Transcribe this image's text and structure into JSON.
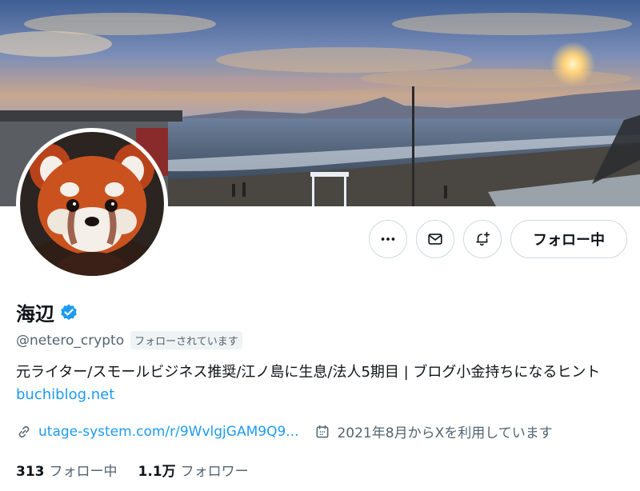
{
  "profile": {
    "display_name": "海辺",
    "handle": "@netero_crypto",
    "follows_you_badge": "フォローされています",
    "bio_text": "元ライター/スモールビジネス推奨/江ノ島に生息/法人5期目 | ブログ小金持ちになるヒント ",
    "bio_link": "buchiblog.net",
    "website": "utage-system.com/r/9WvlgjGAM9Q9...",
    "joined": "2021年8月からXを利用しています",
    "following_count": "313",
    "following_label": "フォロー中",
    "followers_count": "1.1万",
    "followers_label": "フォロワー"
  },
  "actions": {
    "more_icon": "more-icon",
    "message_icon": "mail-icon",
    "notify_icon": "bell-plus-icon",
    "follow_state_label": "フォロー中"
  },
  "colors": {
    "accent": "#1d9bf0",
    "secondary_text": "#536471",
    "border": "#cfd9de"
  }
}
